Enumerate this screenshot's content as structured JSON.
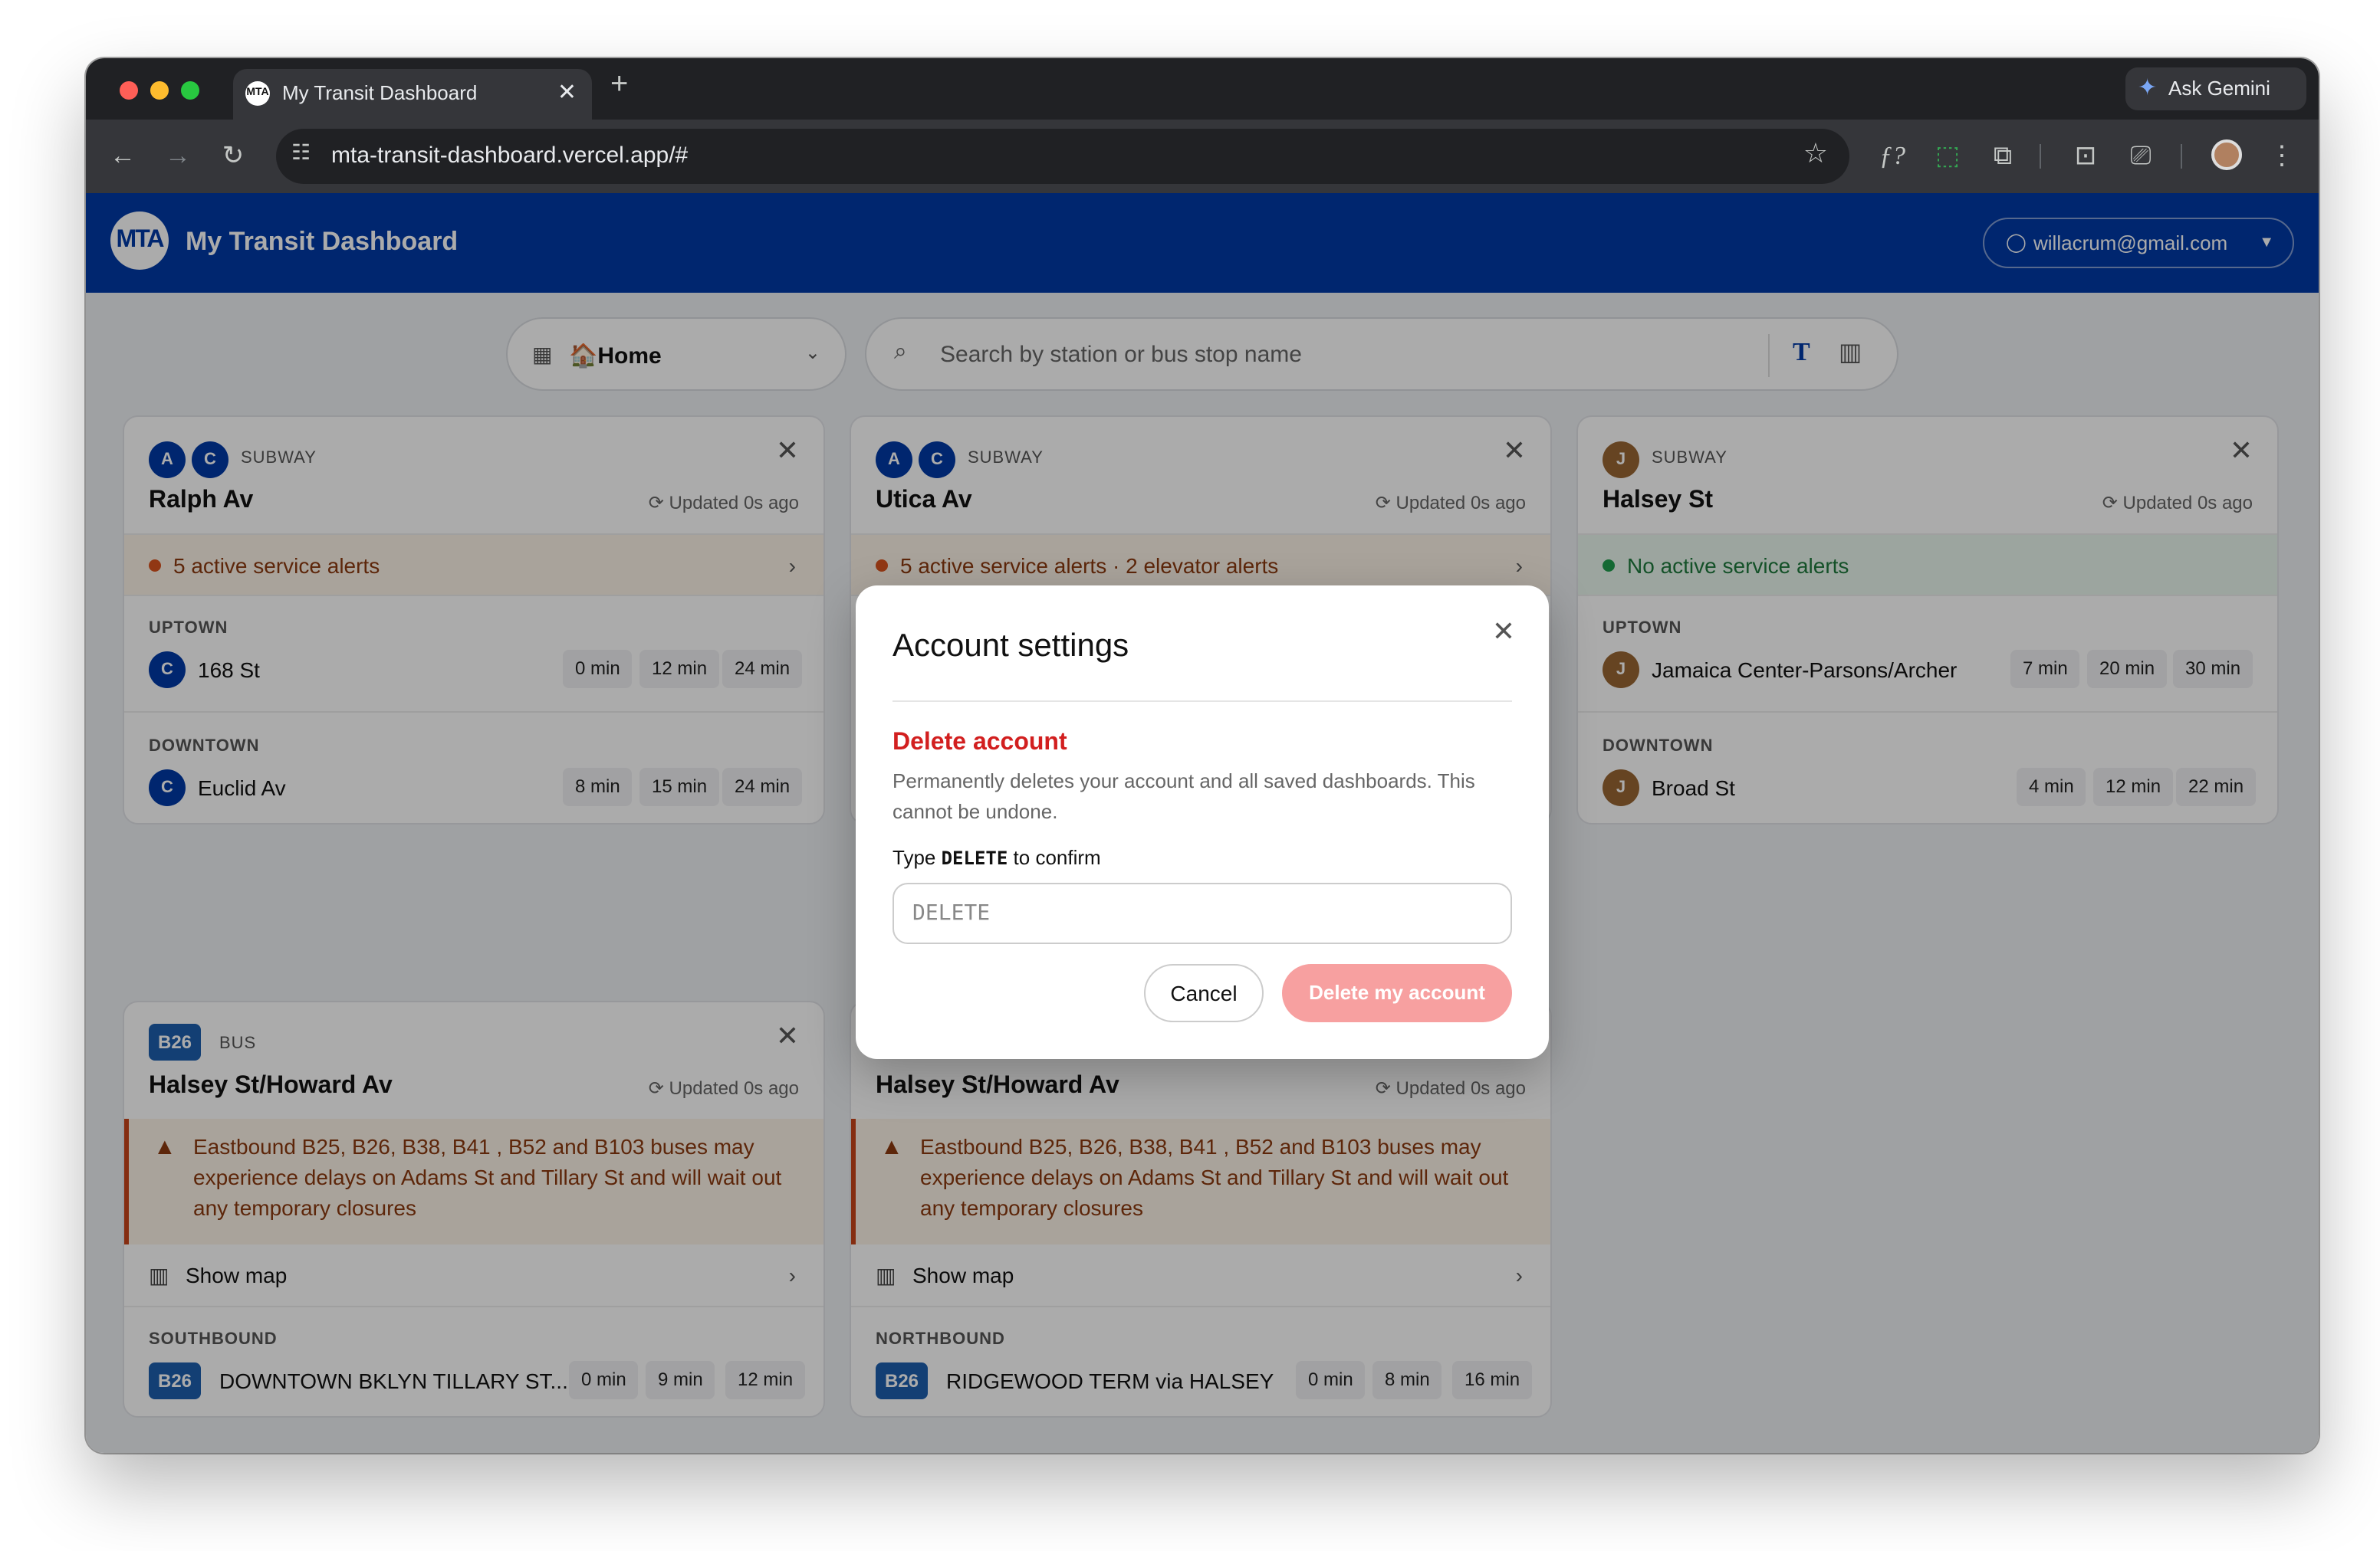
{
  "browser": {
    "tab_title": "My Transit Dashboard",
    "favicon_text": "MTA",
    "new_tab": "+",
    "url": "mta-transit-dashboard.vercel.app/#",
    "ask_gemini": "Ask Gemini",
    "colors": {
      "frame": "#202124",
      "toolbar": "#35363a"
    }
  },
  "header": {
    "logo_text": "MTA",
    "title": "My Transit Dashboard",
    "user_email": "willacrum@gmail.com",
    "brand_color": "#0039a6"
  },
  "controls": {
    "dashboard_select": "🏠Home",
    "search_placeholder": "Search by station or bus stop name"
  },
  "cards": {
    "ralph": {
      "routes": [
        "A",
        "C"
      ],
      "mode": "SUBWAY",
      "station": "Ralph Av",
      "updated": "Updated 0s ago",
      "alert": "5 active service alerts",
      "uptown": {
        "label": "UPTOWN",
        "route": "C",
        "dest": "168 St",
        "times": [
          "0 min",
          "12 min",
          "24 min"
        ]
      },
      "downtown": {
        "label": "DOWNTOWN",
        "route": "C",
        "dest": "Euclid Av",
        "times": [
          "8 min",
          "15 min",
          "24 min"
        ]
      }
    },
    "utica": {
      "routes": [
        "A",
        "C"
      ],
      "mode": "SUBWAY",
      "station": "Utica Av",
      "updated": "Updated 0s ago",
      "alert": "5 active service alerts · 2 elevator alerts"
    },
    "halsey": {
      "routes": [
        "J"
      ],
      "mode": "SUBWAY",
      "station": "Halsey St",
      "updated": "Updated 0s ago",
      "alert": "No active service alerts",
      "uptown": {
        "label": "UPTOWN",
        "route": "J",
        "dest": "Jamaica Center-Parsons/Archer",
        "times": [
          "7 min",
          "20 min",
          "30 min"
        ]
      },
      "downtown": {
        "label": "DOWNTOWN",
        "route": "J",
        "dest": "Broad St",
        "times": [
          "4 min",
          "12 min",
          "22 min"
        ]
      }
    },
    "bus1": {
      "route": "B26",
      "mode": "BUS",
      "station": "Halsey St/Howard Av",
      "updated": "Updated 0s ago",
      "warning": "Eastbound B25, B26, B38, B41 , B52 and B103 buses may experience delays on Adams St and Tillary St and will wait out any temporary closures",
      "show_map": "Show map",
      "dir": {
        "label": "SOUTHBOUND",
        "route": "B26",
        "dest": "DOWNTOWN BKLYN TILLARY ST...",
        "times": [
          "0 min",
          "9 min",
          "12 min"
        ]
      }
    },
    "bus2": {
      "station": "Halsey St/Howard Av",
      "updated": "Updated 0s ago",
      "warning": "Eastbound B25, B26, B38, B41 , B52 and B103 buses may experience delays on Adams St and Tillary St and will wait out any temporary closures",
      "show_map": "Show map",
      "dir": {
        "label": "NORTHBOUND",
        "route": "B26",
        "dest": "RIDGEWOOD TERM via HALSEY",
        "times": [
          "0 min",
          "8 min",
          "16 min"
        ]
      }
    }
  },
  "route_colors": {
    "A": "#0039a6",
    "C": "#0039a6",
    "J": "#996633",
    "B26": "#1d5fae"
  },
  "modal": {
    "title": "Account settings",
    "delete_heading": "Delete account",
    "delete_desc": "Permanently deletes your account and all saved dashboards. This cannot be undone.",
    "confirm_prefix": "Type ",
    "confirm_word": "DELETE",
    "confirm_suffix": " to confirm",
    "input_placeholder": "DELETE",
    "input_value": "",
    "cancel": "Cancel",
    "delete_button": "Delete my account"
  }
}
